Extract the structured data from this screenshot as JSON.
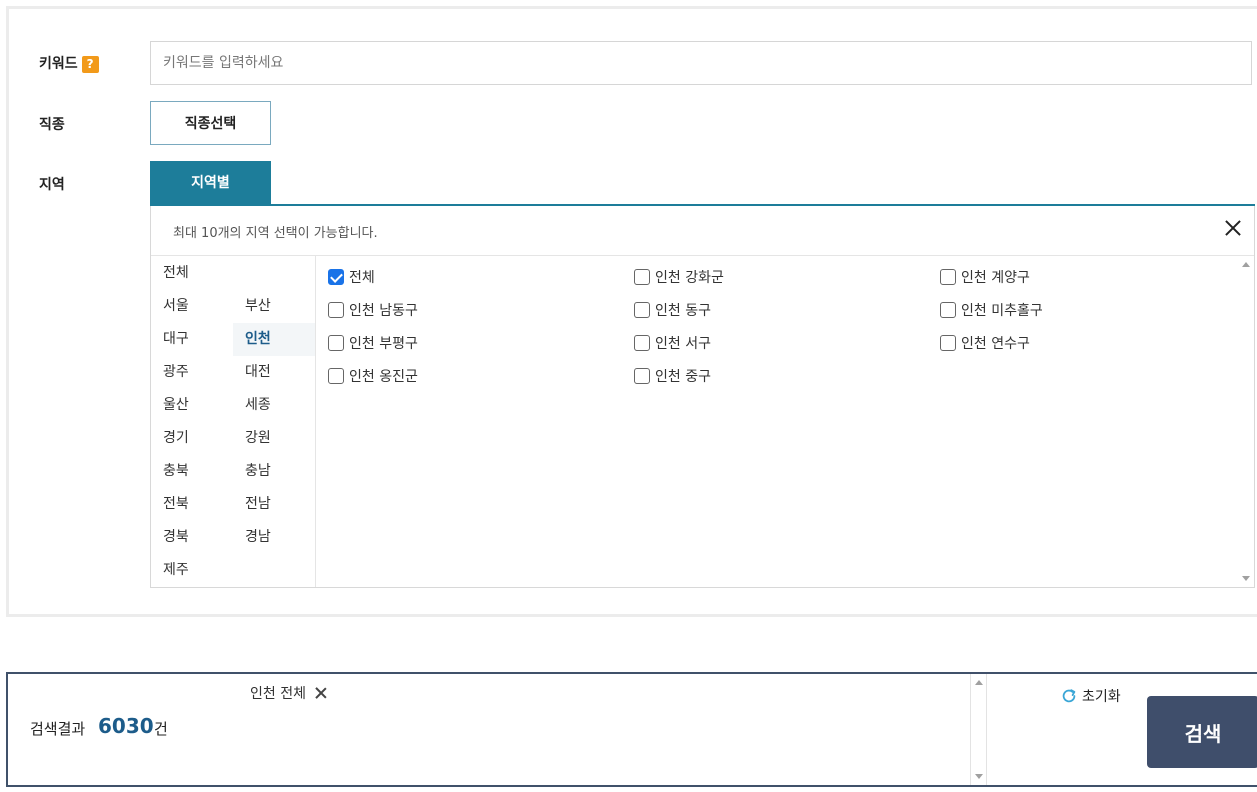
{
  "keyword": {
    "label": "키워드",
    "help_badge": "?",
    "placeholder": "키워드를 입력하세요"
  },
  "job": {
    "label": "직종",
    "button_label": "직종선택"
  },
  "region": {
    "label": "지역",
    "tab_label": "지역별",
    "notice": "최대 10개의 지역 선택이 가능합니다.",
    "sido": [
      {
        "label": "전체"
      },
      {
        "label": "서울"
      },
      {
        "label": "부산"
      },
      {
        "label": "대구"
      },
      {
        "label": "인천",
        "selected": true
      },
      {
        "label": "광주"
      },
      {
        "label": "대전"
      },
      {
        "label": "울산"
      },
      {
        "label": "세종"
      },
      {
        "label": "경기"
      },
      {
        "label": "강원"
      },
      {
        "label": "충북"
      },
      {
        "label": "충남"
      },
      {
        "label": "전북"
      },
      {
        "label": "전남"
      },
      {
        "label": "경북"
      },
      {
        "label": "경남"
      },
      {
        "label": "제주"
      }
    ],
    "gugun": [
      {
        "label": "전체",
        "checked": true
      },
      {
        "label": "인천 강화군",
        "checked": false
      },
      {
        "label": "인천 계양구",
        "checked": false
      },
      {
        "label": "인천 남동구",
        "checked": false
      },
      {
        "label": "인천 동구",
        "checked": false
      },
      {
        "label": "인천 미추홀구",
        "checked": false
      },
      {
        "label": "인천 부평구",
        "checked": false
      },
      {
        "label": "인천 서구",
        "checked": false
      },
      {
        "label": "인천 연수구",
        "checked": false
      },
      {
        "label": "인천 옹진군",
        "checked": false
      },
      {
        "label": "인천 중구",
        "checked": false
      }
    ]
  },
  "results": {
    "selected_chip": "인천 전체",
    "label": "검색결과",
    "count": "6030",
    "unit": "건",
    "reset_label": "초기화",
    "search_label": "검색"
  },
  "colors": {
    "accent": "#1d7d9a",
    "count": "#1d5c8a",
    "search_button": "#3f4e6b",
    "help_badge": "#f29a1a"
  }
}
